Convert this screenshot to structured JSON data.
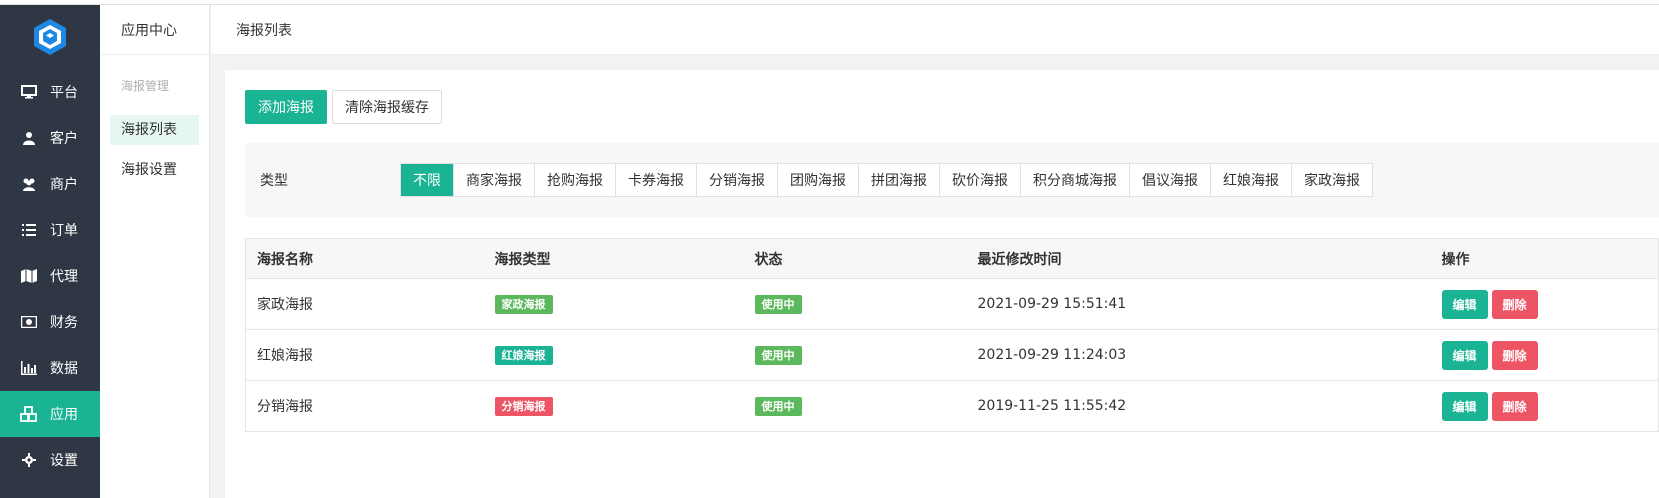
{
  "colors": {
    "accent": "#1ab394",
    "danger": "#ed5565",
    "success": "#5cb85c",
    "nav_bg": "#2f3744"
  },
  "nav": {
    "items": [
      {
        "label": "平台",
        "icon": "monitor-icon"
      },
      {
        "label": "客户",
        "icon": "user-icon"
      },
      {
        "label": "商户",
        "icon": "users-icon"
      },
      {
        "label": "订单",
        "icon": "list-icon"
      },
      {
        "label": "代理",
        "icon": "map-icon"
      },
      {
        "label": "财务",
        "icon": "money-icon"
      },
      {
        "label": "数据",
        "icon": "bar-chart-icon"
      },
      {
        "label": "应用",
        "icon": "cubes-icon",
        "active": true
      },
      {
        "label": "设置",
        "icon": "gear-icon"
      }
    ]
  },
  "subnav": {
    "head": "应用中心",
    "group": "海报管理",
    "items": [
      {
        "label": "海报列表",
        "active": true
      },
      {
        "label": "海报设置"
      }
    ]
  },
  "topbar": {
    "title": "海报列表"
  },
  "actions": {
    "add_label": "添加海报",
    "clear_label": "清除海报缓存"
  },
  "filter": {
    "label": "类型",
    "options": [
      "不限",
      "商家海报",
      "抢购海报",
      "卡券海报",
      "分销海报",
      "团购海报",
      "拼团海报",
      "砍价海报",
      "积分商城海报",
      "倡议海报",
      "红娘海报",
      "家政海报"
    ],
    "selected": "不限"
  },
  "table": {
    "headers": [
      "海报名称",
      "海报类型",
      "状态",
      "最近修改时间",
      "操作"
    ],
    "rows": [
      {
        "name": "家政海报",
        "type": "家政海报",
        "type_color": "#5cb85c",
        "status": "使用中",
        "time": "2021-09-29 15:51:41"
      },
      {
        "name": "红娘海报",
        "type": "红娘海报",
        "type_color": "#1ab394",
        "status": "使用中",
        "time": "2021-09-29 11:24:03"
      },
      {
        "name": "分销海报",
        "type": "分销海报",
        "type_color": "#ed5565",
        "status": "使用中",
        "time": "2019-11-25 11:55:42"
      }
    ],
    "edit_label": "编辑",
    "delete_label": "删除"
  }
}
